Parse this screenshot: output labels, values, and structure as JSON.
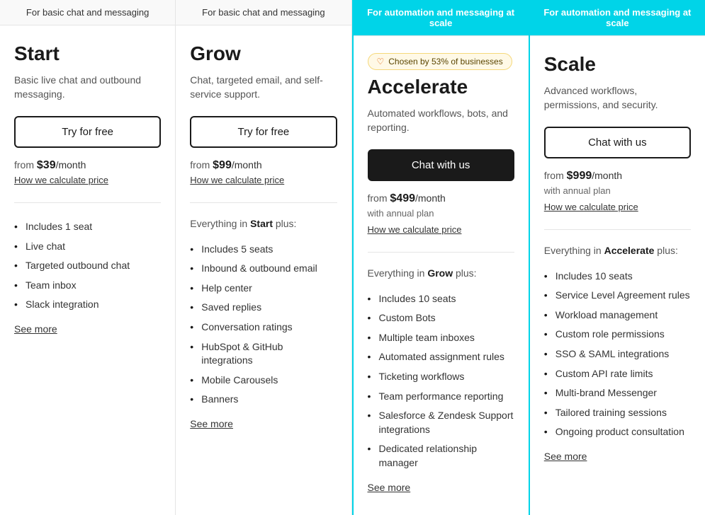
{
  "plans": [
    {
      "id": "start",
      "banner": "For basic chat and messaging",
      "banner_highlighted": false,
      "name": "Start",
      "description": "Basic live chat and outbound messaging.",
      "cta_label": "Try for free",
      "cta_style": "outline",
      "price_prefix": "from",
      "price": "$39",
      "price_period": "/month",
      "price_sub": null,
      "price_link": "How we calculate price",
      "features_intro": null,
      "features": [
        "Includes 1 seat",
        "Live chat",
        "Targeted outbound chat",
        "Team inbox",
        "Slack integration"
      ],
      "see_more": "See more"
    },
    {
      "id": "grow",
      "banner": "For basic chat and messaging",
      "banner_highlighted": false,
      "name": "Grow",
      "description": "Chat, targeted email, and self-service support.",
      "cta_label": "Try for free",
      "cta_style": "outline",
      "price_prefix": "from",
      "price": "$99",
      "price_period": "/month",
      "price_sub": null,
      "price_link": "How we calculate price",
      "features_intro_prefix": "Everything in ",
      "features_intro_bold": "Start",
      "features_intro_suffix": " plus:",
      "features": [
        "Includes 5 seats",
        "Inbound & outbound email",
        "Help center",
        "Saved replies",
        "Conversation ratings",
        "HubSpot & GitHub integrations",
        "Mobile Carousels",
        "Banners"
      ],
      "see_more": "See more"
    },
    {
      "id": "accelerate",
      "banner": "For automation and messaging at scale",
      "banner_highlighted": true,
      "badge_text": "Chosen by 53% of businesses",
      "name": "Accelerate",
      "description": "Automated workflows, bots, and reporting.",
      "cta_label": "Chat with us",
      "cta_style": "dark",
      "price_prefix": "from",
      "price": "$499",
      "price_period": "/month",
      "price_sub": "with annual plan",
      "price_link": "How we calculate price",
      "features_intro_prefix": "Everything in ",
      "features_intro_bold": "Grow",
      "features_intro_suffix": " plus:",
      "features": [
        "Includes 10 seats",
        "Custom Bots",
        "Multiple team inboxes",
        "Automated assignment rules",
        "Ticketing workflows",
        "Team performance reporting",
        "Salesforce & Zendesk Support integrations",
        "Dedicated relationship manager"
      ],
      "see_more": "See more"
    },
    {
      "id": "scale",
      "banner": "For automation and messaging at scale",
      "banner_highlighted": true,
      "name": "Scale",
      "description": "Advanced workflows, permissions, and security.",
      "cta_label": "Chat with us",
      "cta_style": "outline",
      "price_prefix": "from",
      "price": "$999",
      "price_period": "/month",
      "price_sub": "with annual plan",
      "price_link": "How we calculate price",
      "features_intro_prefix": "Everything in ",
      "features_intro_bold": "Accelerate",
      "features_intro_suffix": " plus:",
      "features": [
        "Includes 10 seats",
        "Service Level Agreement rules",
        "Workload management",
        "Custom role permissions",
        "SSO & SAML integrations",
        "Custom API rate limits",
        "Multi-brand Messenger",
        "Tailored training sessions",
        "Ongoing product consultation"
      ],
      "see_more": "See more"
    }
  ]
}
